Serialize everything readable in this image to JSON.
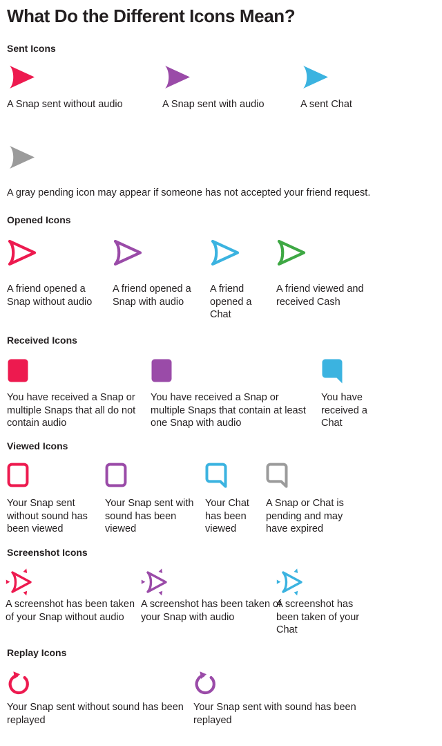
{
  "page": {
    "title": "What Do the Different Icons Mean?",
    "background": "#ffffff",
    "text_color": "#231f20"
  },
  "colors": {
    "pink": "#ED1A4F",
    "purple": "#9A4BA8",
    "blue": "#3BB3E0",
    "green": "#3EA844",
    "gray": "#9B9B9B"
  },
  "sections": [
    {
      "id": "sent-icons",
      "heading": "Sent Icons",
      "items": [
        {
          "icon": "filled-arrow-icon",
          "color_key": "pink",
          "caption": "A Snap sent without audio"
        },
        {
          "icon": "filled-arrow-icon",
          "color_key": "purple",
          "caption": "A Snap sent with audio"
        },
        {
          "icon": "filled-arrow-icon",
          "color_key": "blue",
          "caption": "A sent Chat"
        }
      ],
      "note": {
        "icon": "filled-arrow-icon",
        "color_key": "gray",
        "text": "A gray pending icon may appear if someone has not accepted your friend request."
      }
    },
    {
      "id": "opened-icons",
      "heading": "Opened Icons",
      "items": [
        {
          "icon": "outline-arrow-icon",
          "color_key": "pink",
          "caption": "A friend opened a Snap without audio"
        },
        {
          "icon": "outline-arrow-icon",
          "color_key": "purple",
          "caption": "A friend opened a Snap with audio"
        },
        {
          "icon": "outline-arrow-icon",
          "color_key": "blue",
          "caption": "A friend opened a Chat"
        },
        {
          "icon": "outline-arrow-icon",
          "color_key": "green",
          "caption": "A friend viewed and received Cash"
        }
      ]
    },
    {
      "id": "received-icons",
      "heading": "Received Icons",
      "items": [
        {
          "icon": "filled-square-icon",
          "color_key": "pink",
          "caption": "You have received a Snap or multiple Snaps that all do not contain audio"
        },
        {
          "icon": "filled-square-icon",
          "color_key": "purple",
          "caption": "You have received a Snap or multiple Snaps that contain at least one Snap with audio"
        },
        {
          "icon": "filled-chat-bubble-icon",
          "color_key": "blue",
          "caption": "You have received a Chat"
        }
      ]
    },
    {
      "id": "viewed-icons",
      "heading": "Viewed Icons",
      "items": [
        {
          "icon": "outline-square-icon",
          "color_key": "pink",
          "caption": "Your Snap sent without sound has been viewed"
        },
        {
          "icon": "outline-square-icon",
          "color_key": "purple",
          "caption": "Your Snap sent with sound has been viewed"
        },
        {
          "icon": "outline-chat-bubble-icon",
          "color_key": "blue",
          "caption": "Your Chat has been viewed"
        },
        {
          "icon": "outline-chat-bubble-icon",
          "color_key": "gray",
          "caption": "A Snap or Chat is pending and may have expired"
        }
      ]
    },
    {
      "id": "screenshot-icons",
      "heading": "Screenshot Icons",
      "items": [
        {
          "icon": "screenshot-arrow-icon",
          "color_key": "pink",
          "caption": "A screenshot has been taken of your Snap without audio"
        },
        {
          "icon": "screenshot-arrow-icon",
          "color_key": "purple",
          "caption": "A screenshot has been taken of your Snap with audio"
        },
        {
          "icon": "screenshot-arrow-icon",
          "color_key": "blue",
          "caption": "A screenshot has been taken of your Chat"
        }
      ]
    },
    {
      "id": "replay-icons",
      "heading": "Replay Icons",
      "items": [
        {
          "icon": "replay-circle-arrow-icon",
          "color_key": "pink",
          "caption": "Your Snap sent without sound has been replayed"
        },
        {
          "icon": "replay-circle-arrow-icon",
          "color_key": "purple",
          "caption": "Your Snap sent with sound has been replayed"
        }
      ]
    }
  ]
}
